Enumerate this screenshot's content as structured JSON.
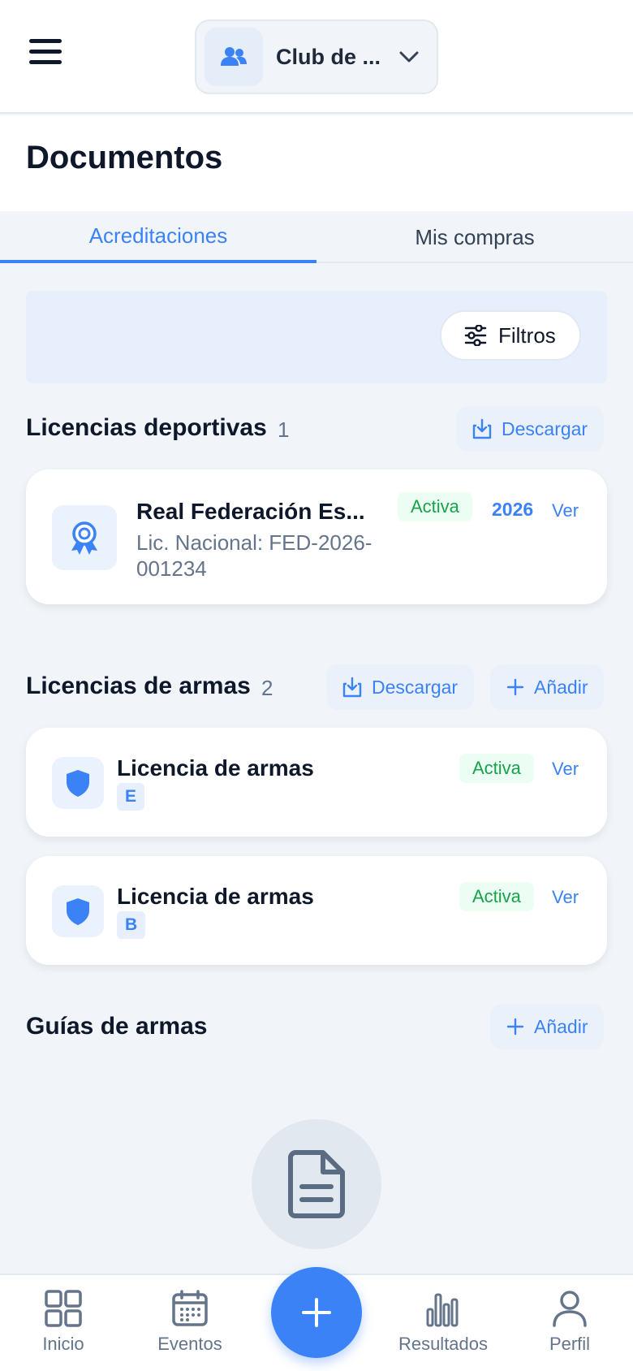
{
  "header": {
    "club_label": "Club de ...",
    "icons": {
      "menu": "hamburger-icon",
      "club": "users-icon",
      "chevron": "chevron-down-icon"
    }
  },
  "page": {
    "title": "Documentos"
  },
  "tabs": [
    {
      "label": "Acreditaciones",
      "active": true
    },
    {
      "label": "Mis compras",
      "active": false
    }
  ],
  "filters": {
    "label": "Filtros",
    "icon": "sliders-icon"
  },
  "sections": {
    "sports_licenses": {
      "title": "Licencias deportivas",
      "count": "1",
      "download_label": "Descargar",
      "items": [
        {
          "title": "Real Federación Es...",
          "subtitle": "Lic. Nacional: FED-2026-001234",
          "status": "Activa",
          "year": "2026",
          "view_label": "Ver",
          "icon": "award-icon"
        }
      ]
    },
    "weapon_licenses": {
      "title": "Licencias de armas",
      "count": "2",
      "download_label": "Descargar",
      "add_label": "Añadir",
      "items": [
        {
          "title": "Licencia de armas",
          "class": "E",
          "status": "Activa",
          "view_label": "Ver",
          "icon": "shield-icon"
        },
        {
          "title": "Licencia de armas",
          "class": "B",
          "status": "Activa",
          "view_label": "Ver",
          "icon": "shield-icon"
        }
      ]
    },
    "weapon_guides": {
      "title": "Guías de armas",
      "add_label": "Añadir",
      "empty_icon": "document-icon"
    }
  },
  "bottom_nav": {
    "items": [
      {
        "label": "Inicio",
        "icon": "grid-icon"
      },
      {
        "label": "Eventos",
        "icon": "calendar-icon"
      },
      {
        "label": "Resultados",
        "icon": "bar-chart-icon"
      },
      {
        "label": "Perfil",
        "icon": "user-icon"
      }
    ],
    "fab_icon": "plus-icon"
  },
  "colors": {
    "accent": "#3b82f6",
    "success": "#16a34a",
    "background": "#f1f5f9",
    "text": "#0f172a",
    "muted": "#64748b"
  }
}
